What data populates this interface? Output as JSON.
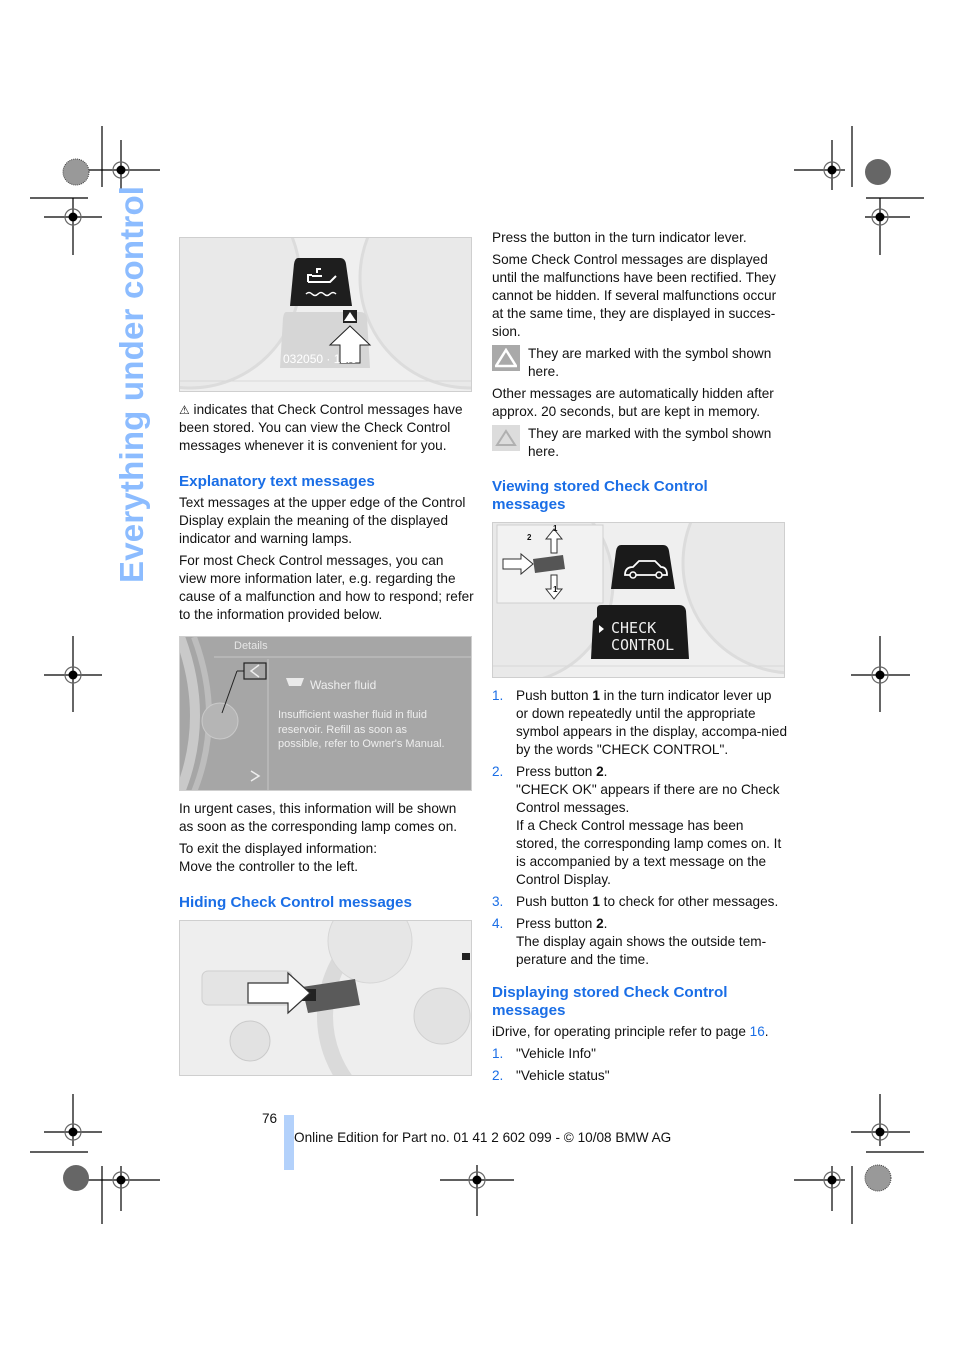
{
  "side_title": "Everything under control",
  "left_column": {
    "figure1": {
      "icon": "oil-level-warning-icon",
      "display_readout": "032050 · 12.8",
      "marker": "warning-triangle-icon"
    },
    "intro_text": "indicates that Check Control messages have been stored. You can view the Check Control messages whenever it is convenient for you.",
    "explanatory": {
      "heading": "Explanatory text messages",
      "p1": "Text messages at the upper edge of the Control Display explain the meaning of the displayed indicator and warning lamps.",
      "p2": "For most Check Control messages, you can view more information later, e.g. regarding the cause of a malfunction and how to respond; refer to the information provided below."
    },
    "figure2": {
      "header": "Details",
      "title": "Washer fluid",
      "message": "Insufficient washer fluid in fluid reservoir. Refill as soon as possible, refer to Owner's Manual."
    },
    "urgent_text": "In urgent cases, this information will be shown as soon as the corresponding lamp comes on.",
    "exit_text_1": "To exit the displayed information:",
    "exit_text_2": "Move the controller to the left.",
    "hiding": {
      "heading": "Hiding Check Control messages"
    }
  },
  "right_column": {
    "press_text": "Press the button in the turn indicator lever.",
    "some_text": "Some Check Control messages are displayed until the malfunctions have been rectified. They cannot be hidden. If several malfunctions occur at the same time, they are displayed in succes-sion.",
    "note1": "They are marked with the symbol shown here.",
    "other_text": "Other messages are automatically hidden after approx. 20 seconds, but are kept in memory.",
    "note2": "They are marked with the symbol shown here.",
    "viewing": {
      "heading_1": "Viewing stored Check Control",
      "heading_2": "messages",
      "figure": {
        "display_line1": "CHECK",
        "display_line2": "CONTROL",
        "button1_label": "1",
        "button2_label": "2"
      },
      "steps": [
        {
          "num": "1.",
          "pre": "Push button ",
          "bold": "1",
          "post": " in the turn indicator lever up or down repeatedly until the appropriate symbol appears in the display, accompa-nied by the words \"CHECK CONTROL\"."
        },
        {
          "num": "2.",
          "pre": "Press button ",
          "bold": "2",
          "post": ".",
          "extra1": "\"CHECK OK\" appears if there are no Check Control messages.",
          "extra2": "If a Check Control message has been stored, the corresponding lamp comes on. It is accompanied by a text message on the Control Display."
        },
        {
          "num": "3.",
          "pre": "Push button ",
          "bold": "1",
          "post": " to check for other messages."
        },
        {
          "num": "4.",
          "pre": "Press button ",
          "bold": "2",
          "post": ".",
          "extra1": "The display again shows the outside tem-perature and the time."
        }
      ]
    },
    "displaying": {
      "heading_1": "Displaying stored Check Control",
      "heading_2": "messages",
      "intro_pre": "iDrive, for operating principle refer to page ",
      "intro_link": "16",
      "intro_post": ".",
      "steps": [
        {
          "num": "1.",
          "text": "\"Vehicle Info\""
        },
        {
          "num": "2.",
          "text": "\"Vehicle status\""
        }
      ]
    }
  },
  "footer": {
    "page_number": "76",
    "edition": "Online Edition for Part no. 01 41 2 602 099 - © 10/08 BMW AG"
  },
  "colors": {
    "heading_blue": "#1a6ee6",
    "side_title_blue": "#8cbcff",
    "footer_bar": "#b3d1fb"
  }
}
